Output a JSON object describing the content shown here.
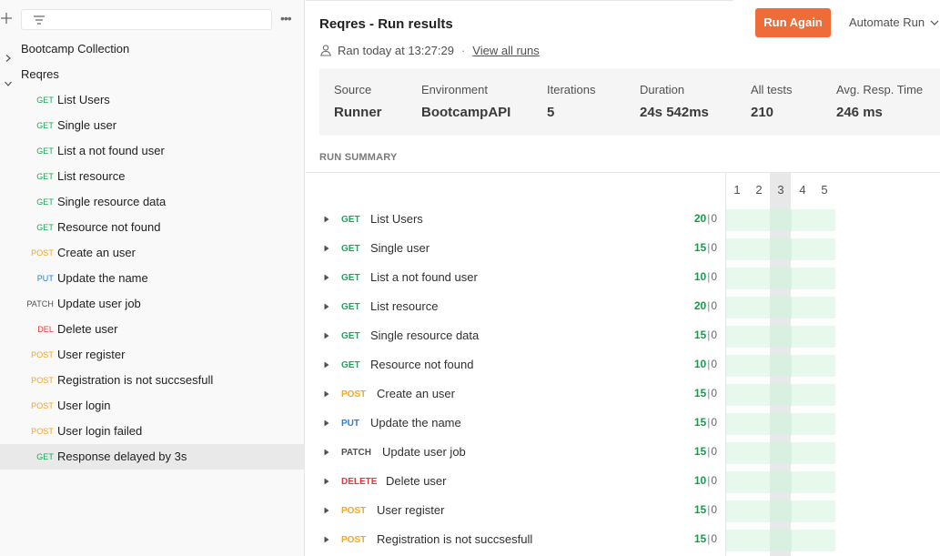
{
  "colors": {
    "get": "#22a05a",
    "post": "#f4a32a",
    "put": "#2f7bd0",
    "patch": "#505050",
    "delete": "#e13a3a",
    "accent": "#ef6b38",
    "pass": "#1a9a4b"
  },
  "sidebar": {
    "icons": {
      "add": "plus-icon",
      "filter": "filter-icon",
      "more": "more-icon"
    },
    "more_glyph": "•••",
    "collections": [
      {
        "label": "Bootcamp Collection",
        "expanded": false
      },
      {
        "label": "Reqres",
        "expanded": true
      }
    ],
    "requests": [
      {
        "method": "GET",
        "label": "List Users"
      },
      {
        "method": "GET",
        "label": "Single user"
      },
      {
        "method": "GET",
        "label": "List a not found user"
      },
      {
        "method": "GET",
        "label": "List resource"
      },
      {
        "method": "GET",
        "label": "Single resource data"
      },
      {
        "method": "GET",
        "label": "Resource not found"
      },
      {
        "method": "POST",
        "label": "Create an user"
      },
      {
        "method": "PUT",
        "label": "Update the name"
      },
      {
        "method": "PATCH",
        "label": "Update user job"
      },
      {
        "method": "DEL",
        "label": "Delete user"
      },
      {
        "method": "POST",
        "label": "User register"
      },
      {
        "method": "POST",
        "label": "Registration is not succsesfull"
      },
      {
        "method": "POST",
        "label": "User login"
      },
      {
        "method": "POST",
        "label": "User login failed"
      },
      {
        "method": "GET",
        "label": "Response delayed by 3s",
        "selected": true
      }
    ]
  },
  "header": {
    "title": "Reqres - Run results",
    "ran_text": "Ran today at 13:27:29",
    "separator": "·",
    "view_all_runs": "View all runs",
    "run_again": "Run Again",
    "automate_run": "Automate Run"
  },
  "stats": [
    {
      "label": "Source",
      "value": "Runner"
    },
    {
      "label": "Environment",
      "value": "BootcampAPI"
    },
    {
      "label": "Iterations",
      "value": "5"
    },
    {
      "label": "Duration",
      "value": "24s 542ms"
    },
    {
      "label": "All tests",
      "value": "210"
    },
    {
      "label": "Avg. Resp. Time",
      "value": "246 ms"
    }
  ],
  "summary": {
    "title": "RUN SUMMARY",
    "iterations": [
      "1",
      "2",
      "3",
      "4",
      "5"
    ],
    "highlighted_iteration": "3",
    "rows": [
      {
        "method": "GET",
        "name": "List Users",
        "passed": "20",
        "failed": "0"
      },
      {
        "method": "GET",
        "name": "Single user",
        "passed": "15",
        "failed": "0"
      },
      {
        "method": "GET",
        "name": "List a not found user",
        "passed": "10",
        "failed": "0"
      },
      {
        "method": "GET",
        "name": "List resource",
        "passed": "20",
        "failed": "0"
      },
      {
        "method": "GET",
        "name": "Single resource data",
        "passed": "15",
        "failed": "0"
      },
      {
        "method": "GET",
        "name": "Resource not found",
        "passed": "10",
        "failed": "0"
      },
      {
        "method": "POST",
        "name": "Create an user",
        "passed": "15",
        "failed": "0"
      },
      {
        "method": "PUT",
        "name": "Update the name",
        "passed": "15",
        "failed": "0"
      },
      {
        "method": "PATCH",
        "name": "Update user job",
        "passed": "15",
        "failed": "0"
      },
      {
        "method": "DELETE",
        "name": "Delete user",
        "passed": "10",
        "failed": "0"
      },
      {
        "method": "POST",
        "name": "User register",
        "passed": "15",
        "failed": "0"
      },
      {
        "method": "POST",
        "name": "Registration is not succsesfull",
        "passed": "15",
        "failed": "0"
      }
    ]
  }
}
